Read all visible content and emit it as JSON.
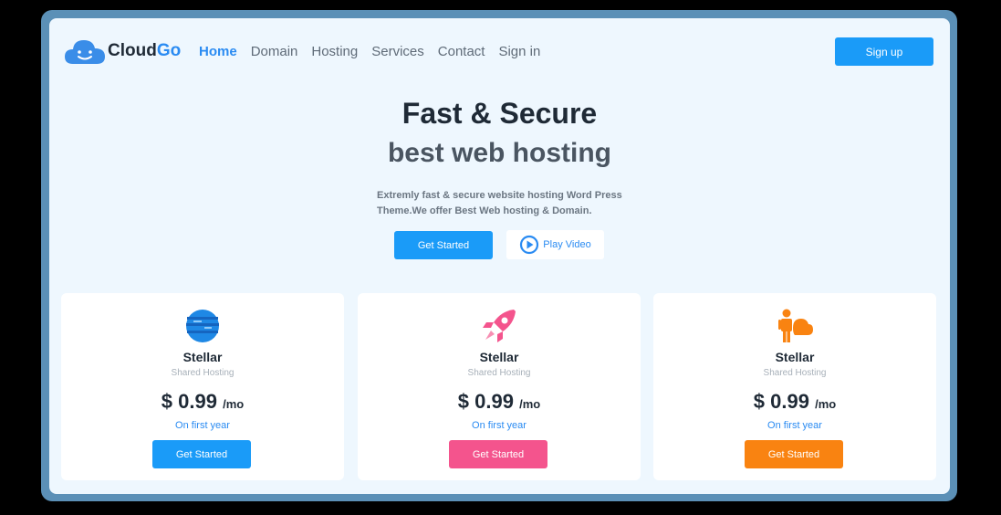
{
  "brand": {
    "name_part1": "Cloud",
    "name_part2": "Go"
  },
  "nav": {
    "items": [
      {
        "label": "Home",
        "active": true
      },
      {
        "label": "Domain"
      },
      {
        "label": "Hosting"
      },
      {
        "label": "Services"
      },
      {
        "label": "Contact"
      },
      {
        "label": "Sign in"
      }
    ],
    "signup_label": "Sign up"
  },
  "hero": {
    "title": "Fast & Secure",
    "subtitle": "best web hosting",
    "description_line1": "Extremly fast & secure website hosting Word Press",
    "description_line2": "Theme.We offer Best Web hosting & Domain.",
    "get_started_label": "Get Started",
    "play_video_label": "Play Video"
  },
  "plans": [
    {
      "icon": "globe-icon",
      "name": "Stellar",
      "type": "Shared Hosting",
      "price": "$ 0.99",
      "period": "/mo",
      "note": "On first year",
      "cta": "Get Started",
      "color": "#1a9bf8"
    },
    {
      "icon": "rocket-icon",
      "name": "Stellar",
      "type": "Shared Hosting",
      "price": "$ 0.99",
      "period": "/mo",
      "note": "On first year",
      "cta": "Get Started",
      "color": "#f4548d"
    },
    {
      "icon": "person-cloud-icon",
      "name": "Stellar",
      "type": "Shared Hosting",
      "price": "$ 0.99",
      "period": "/mo",
      "note": "On first year",
      "cta": "Get Started",
      "color": "#f98311"
    }
  ],
  "colors": {
    "accent": "#1a9bf8",
    "frame": "#5b90b7",
    "page_bg": "#eef7fe"
  }
}
